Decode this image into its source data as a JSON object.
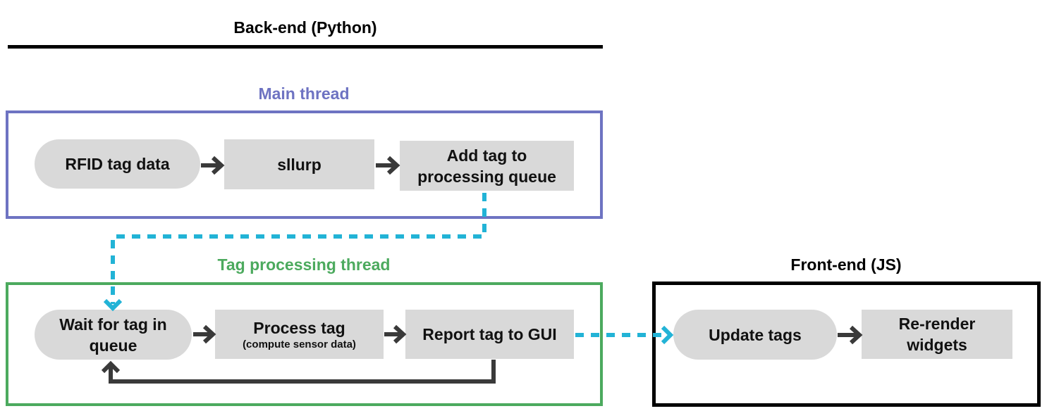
{
  "backend": {
    "title": "Back-end (Python)",
    "main_thread": {
      "label": "Main thread",
      "color": "#6e73c2",
      "nodes": [
        {
          "id": "rfid",
          "label": "RFID tag data",
          "shape": "pill"
        },
        {
          "id": "sllurp",
          "label": "sllurp",
          "shape": "rect"
        },
        {
          "id": "add-queue",
          "label": "Add tag to processing queue",
          "shape": "rect"
        }
      ]
    },
    "tag_processing_thread": {
      "label": "Tag processing thread",
      "color": "#4caa5e",
      "nodes": [
        {
          "id": "wait",
          "label": "Wait for tag in queue",
          "shape": "pill"
        },
        {
          "id": "process",
          "label": "Process tag",
          "sublabel": "(compute sensor data)",
          "shape": "rect"
        },
        {
          "id": "report",
          "label": "Report tag to GUI",
          "shape": "rect"
        }
      ]
    }
  },
  "frontend": {
    "title": "Front-end (JS)",
    "color": "#000000",
    "nodes": [
      {
        "id": "update",
        "label": "Update tags",
        "shape": "pill"
      },
      {
        "id": "rerender",
        "label": "Re-render widgets",
        "shape": "rect"
      }
    ]
  },
  "edges": [
    {
      "from": "rfid",
      "to": "sllurp",
      "style": "solid"
    },
    {
      "from": "sllurp",
      "to": "add-queue",
      "style": "solid"
    },
    {
      "from": "add-queue",
      "to": "wait",
      "style": "dashed"
    },
    {
      "from": "wait",
      "to": "process",
      "style": "solid"
    },
    {
      "from": "process",
      "to": "report",
      "style": "solid"
    },
    {
      "from": "report",
      "to": "wait",
      "style": "solid"
    },
    {
      "from": "report",
      "to": "update",
      "style": "dashed"
    },
    {
      "from": "update",
      "to": "rerender",
      "style": "solid"
    }
  ],
  "colors": {
    "node_fill": "#d9d9d9",
    "solid_arrow": "#3a3a3a",
    "dashed_arrow": "#22b3d6",
    "text": "#111111"
  }
}
